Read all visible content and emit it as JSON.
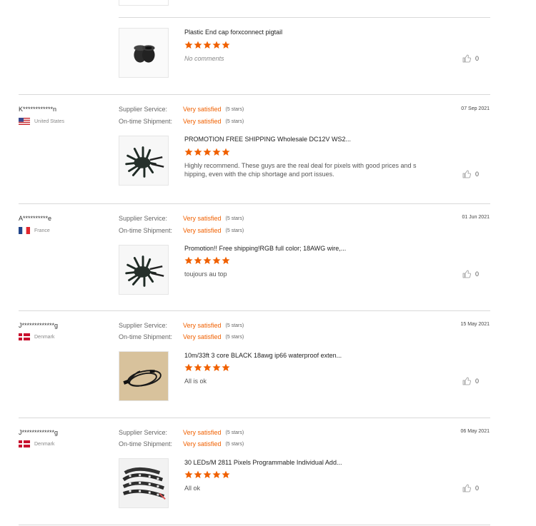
{
  "colors": {
    "accent": "#f06000",
    "star": "#f06000",
    "divider": "#d9d9d9"
  },
  "rating_labels": {
    "supplier": "Supplier Service:",
    "shipment": "On-time Shipment:"
  },
  "top_item": {
    "title": "Plastic End cap forxconnect pigtail",
    "stars": 5,
    "comment": "No comments",
    "likes": "0",
    "thumb_icon": "end-cap-image"
  },
  "reviews": [
    {
      "buyer": "K************n",
      "country": "United States",
      "flag": "us",
      "supplier_rating": "Very satisfied",
      "supplier_stars": "(5 stars)",
      "shipment_rating": "Very satisfied",
      "shipment_stars": "(5 stars)",
      "date": "07 Sep 2021",
      "product_title": "PROMOTION FREE SHIPPING Wholesale DC12V WS2...",
      "stars": 5,
      "comment": "Highly recommend. These guys are the real deal for pixels with good prices and s hipping, even with the chip shortage and port issues.",
      "likes": "0",
      "thumb_icon": "led-pixel-string-image"
    },
    {
      "buyer": "A**********e",
      "country": "France",
      "flag": "fr",
      "supplier_rating": "Very satisfied",
      "supplier_stars": "(5 stars)",
      "shipment_rating": "Very satisfied",
      "shipment_stars": "(5 stars)",
      "date": "01 Jun 2021",
      "product_title": "Promotion!! Free shipping!RGB full color; 18AWG wire,...",
      "stars": 5,
      "comment": "toujours au top",
      "likes": "0",
      "thumb_icon": "led-pixel-string-image"
    },
    {
      "buyer": "J*************g",
      "country": "Denmark",
      "flag": "dk",
      "supplier_rating": "Very satisfied",
      "supplier_stars": "(5 stars)",
      "shipment_rating": "Very satisfied",
      "shipment_stars": "(5 stars)",
      "date": "15 May 2021",
      "product_title": "10m/33ft 3 core BLACK 18awg ip66 waterproof exten...",
      "stars": 5,
      "comment": "All is ok",
      "likes": "0",
      "thumb_icon": "extension-cable-image"
    },
    {
      "buyer": "J*************g",
      "country": "Denmark",
      "flag": "dk",
      "supplier_rating": "Very satisfied",
      "supplier_stars": "(5 stars)",
      "shipment_rating": "Very satisfied",
      "shipment_stars": "(5 stars)",
      "date": "06 May 2021",
      "product_title": "30 LEDs/M 2811 Pixels Programmable Individual Add...",
      "stars": 5,
      "comment": "All ok",
      "likes": "0",
      "thumb_icon": "led-strip-image"
    }
  ]
}
